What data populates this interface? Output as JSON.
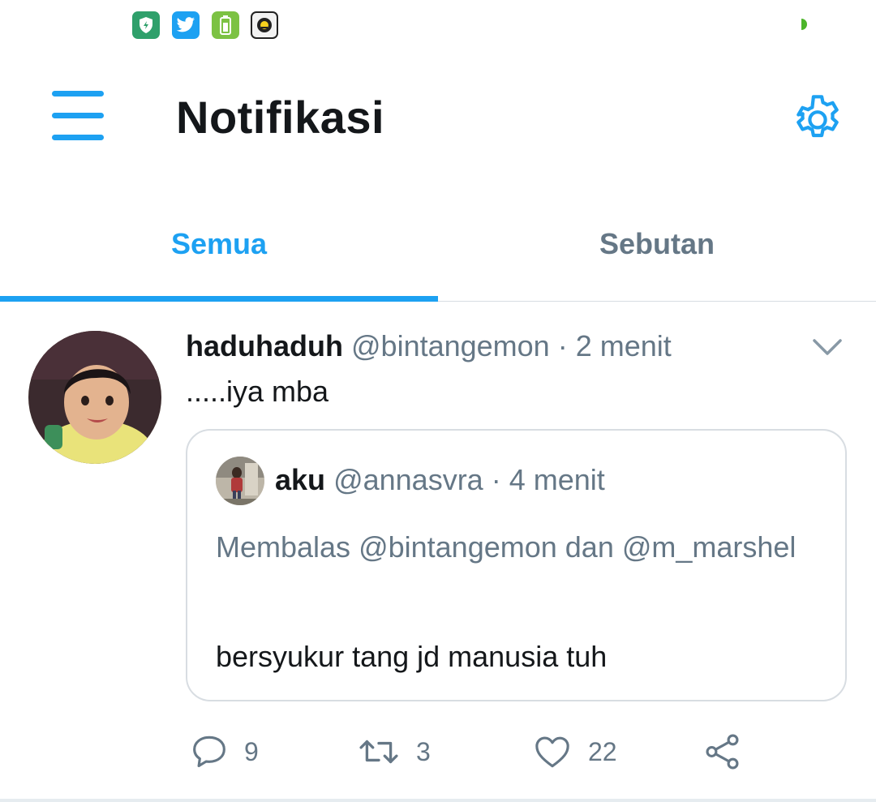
{
  "status_bar": {
    "icons": [
      "shield-icon",
      "twitter-icon",
      "battery-saver-icon",
      "chat-app-icon"
    ],
    "indicator_color": "#4cb52a"
  },
  "app_bar": {
    "title": "Notifikasi",
    "menu_icon": "menu-icon",
    "settings_icon": "gear-icon",
    "accent_color": "#1da1f2"
  },
  "tabs": [
    {
      "label": "Semua",
      "active": true
    },
    {
      "label": "Sebutan",
      "active": false
    }
  ],
  "tweet": {
    "name": "haduhaduh",
    "handle": "@bintangemon",
    "separator": "·",
    "time": "2 menit",
    "text": ".....iya mba",
    "quoted": {
      "name": "aku",
      "handle": "@annasvra",
      "separator": "·",
      "time": "4 menit",
      "reply_to": "Membalas @bintangemon dan @m_marshel",
      "text": "bersyukur tang jd manusia tuh"
    },
    "actions": {
      "replies": "9",
      "retweets": "3",
      "likes": "22"
    }
  }
}
